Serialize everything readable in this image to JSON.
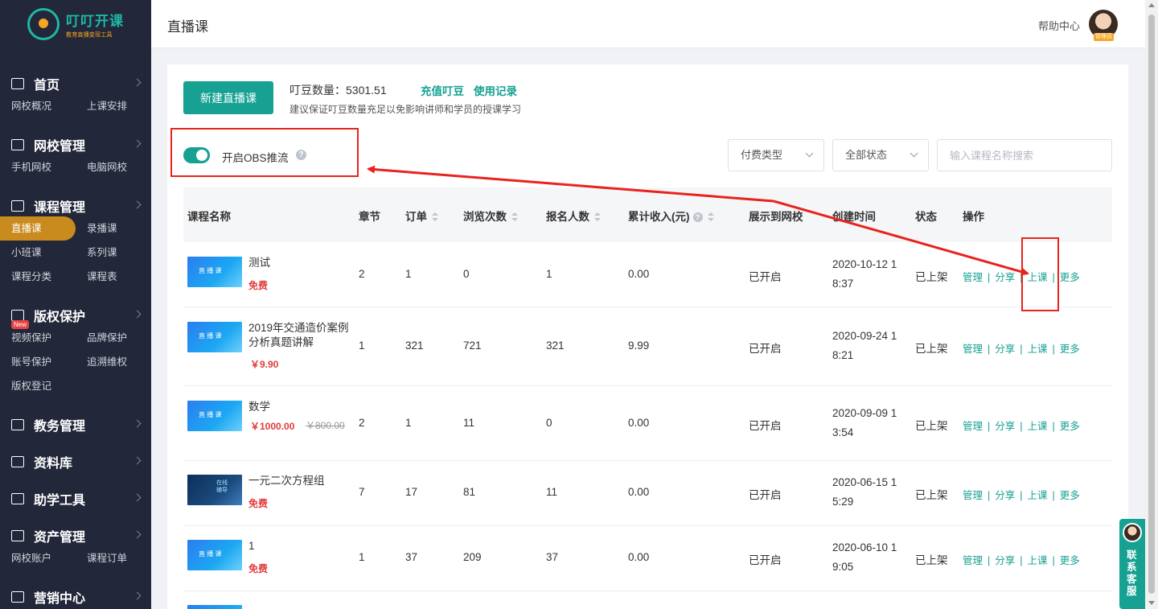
{
  "logo": {
    "title": "叮叮开课",
    "subtitle": "教育直播变现工具"
  },
  "sidebar": {
    "groups": [
      {
        "title": "首页",
        "icon": "chart-icon",
        "items": [
          "网校概况",
          "上课安排"
        ]
      },
      {
        "title": "网校管理",
        "icon": "store-icon",
        "items": [
          "手机网校",
          "电脑网校"
        ]
      },
      {
        "title": "课程管理",
        "icon": "play-icon",
        "items": [
          "直播课",
          "录播课",
          "小班课",
          "系列课",
          "课程分类",
          "课程表"
        ]
      },
      {
        "title": "版权保护",
        "icon": "video-icon",
        "badge": "New",
        "items": [
          "视频保护",
          "品牌保护",
          "账号保护",
          "追溯维权",
          "版权登记"
        ]
      },
      {
        "title": "教务管理",
        "icon": "id-card-icon",
        "items": []
      },
      {
        "title": "资料库",
        "icon": "folder-icon",
        "items": []
      },
      {
        "title": "助学工具",
        "icon": "doc-icon",
        "items": []
      },
      {
        "title": "资产管理",
        "icon": "wallet-icon",
        "items": [
          "网校账户",
          "课程订单"
        ]
      },
      {
        "title": "营销中心",
        "icon": "tag-icon",
        "items": []
      }
    ],
    "active_item": "直播课"
  },
  "header": {
    "title": "直播课",
    "help": "帮助中心",
    "role": "管理员"
  },
  "toolbar": {
    "new_button": "新建直播课",
    "bean_label": "叮豆数量：5301.51",
    "recharge": "充值叮豆",
    "records": "使用记录",
    "hint": "建议保证叮豆数量充足以免影响讲师和学员的授课学习",
    "obs_label": "开启OBS推流",
    "obs_enabled": true,
    "pay_type": "付费类型",
    "status": "全部状态",
    "search_placeholder": "输入课程名称搜索"
  },
  "table": {
    "headers": [
      "课程名称",
      "章节",
      "订单",
      "浏览次数",
      "报名人数",
      "累计收入(元)",
      "展示到网校",
      "创建时间",
      "状态",
      "操作"
    ],
    "rows": [
      {
        "name": "测试",
        "price": "免费",
        "chapters": "2",
        "orders": "1",
        "views": "0",
        "signups": "1",
        "income": "0.00",
        "display": "已开启",
        "created_a": "2020-10-12 1",
        "created_b": "8:37",
        "status": "已上架"
      },
      {
        "name": "2019年交通造价案例分析真题讲解",
        "price": "￥9.90",
        "chapters": "1",
        "orders": "321",
        "views": "721",
        "signups": "321",
        "income": "9.99",
        "display": "已开启",
        "created_a": "2020-09-24 1",
        "created_b": "8:21",
        "status": "已上架"
      },
      {
        "name": "数学",
        "price": "￥1000.00",
        "old_price": "￥800.00",
        "chapters": "2",
        "orders": "1",
        "views": "11",
        "signups": "0",
        "income": "0.00",
        "display": "已开启",
        "created_a": "2020-09-09 1",
        "created_b": "3:54",
        "status": "已上架"
      },
      {
        "name": "一元二次方程组",
        "price": "免费",
        "chapters": "7",
        "orders": "17",
        "views": "81",
        "signups": "11",
        "income": "0.00",
        "display": "已开启",
        "created_a": "2020-06-15 1",
        "created_b": "5:29",
        "status": "已上架"
      },
      {
        "name": "1",
        "price": "免费",
        "chapters": "1",
        "orders": "37",
        "views": "209",
        "signups": "37",
        "income": "0.00",
        "display": "已开启",
        "created_a": "2020-06-10 1",
        "created_b": "9:05",
        "status": "已上架"
      }
    ],
    "ops": [
      "管理",
      "分享",
      "上课",
      "更多"
    ]
  },
  "customer_service": "联系客服",
  "colors": {
    "accent": "#16a193",
    "annotation": "#e8231e",
    "sidebar": "#22273a",
    "active": "#c98a1e",
    "price": "#e23b3b"
  }
}
